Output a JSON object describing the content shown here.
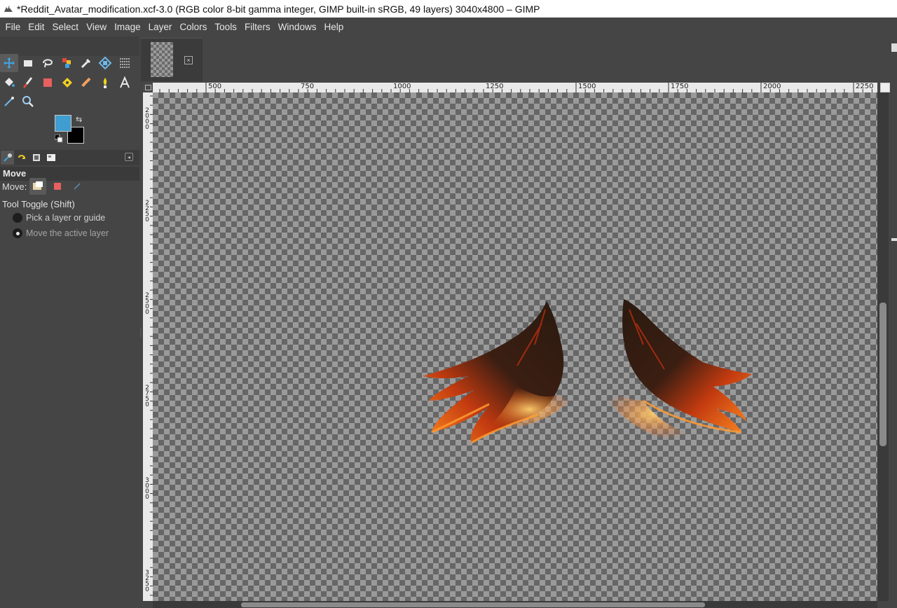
{
  "window": {
    "title": "*Reddit_Avatar_modification.xcf-3.0 (RGB color 8-bit gamma integer, GIMP built-in sRGB, 49 layers) 3040x4800 – GIMP"
  },
  "menu": [
    "File",
    "Edit",
    "Select",
    "View",
    "Image",
    "Layer",
    "Colors",
    "Tools",
    "Filters",
    "Windows",
    "Help"
  ],
  "tools": {
    "rows": [
      [
        "move-icon",
        "rect-select-icon",
        "free-select-icon",
        "fuzzy-select-icon",
        "color-picker-icon",
        "unified-transform-icon",
        "warp-icon"
      ],
      [
        "bucket-fill-icon",
        "paintbrush-icon",
        "eraser-icon",
        "heal-icon",
        "smudge-icon",
        "dodge-icon",
        "text-icon"
      ],
      [
        "paths-icon",
        "zoom-icon"
      ]
    ],
    "active": "move-icon"
  },
  "colors": {
    "foreground": "#3f9dd0",
    "background": "#000000"
  },
  "tool_options": {
    "header": "Move",
    "move_label": "Move:",
    "toggle_label": "Tool Toggle  (Shift)",
    "option_pick": "Pick a layer or guide",
    "option_active": "Move the active layer",
    "selected_option": "Move the active layer"
  },
  "rulers": {
    "horizontal": [
      "500",
      "750",
      "1000",
      "1250",
      "1500",
      "1750",
      "2000",
      "2250"
    ],
    "vertical": [
      "2000",
      "2250",
      "2500",
      "2750",
      "3000",
      "3250"
    ]
  },
  "canvas": {
    "content": "fire wings artwork on transparent background"
  }
}
